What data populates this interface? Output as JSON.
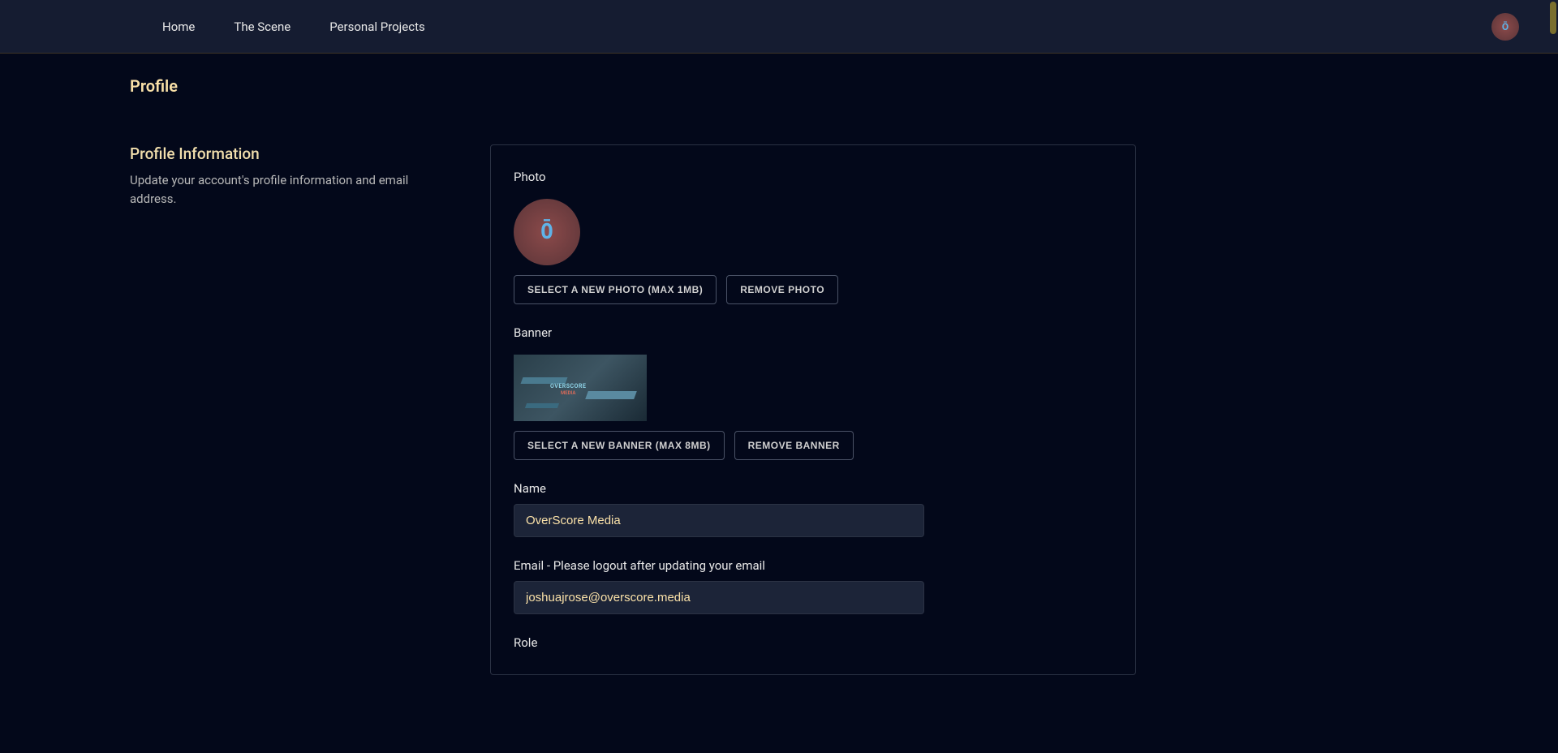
{
  "nav": {
    "items": [
      {
        "label": "Home"
      },
      {
        "label": "The Scene"
      },
      {
        "label": "Personal Projects"
      }
    ],
    "avatar_glyph": "Ō"
  },
  "page": {
    "title": "Profile"
  },
  "section": {
    "heading": "Profile Information",
    "description": "Update your account's profile information and email address."
  },
  "form": {
    "photo": {
      "label": "Photo",
      "glyph": "Ō",
      "select_btn": "SELECT A NEW PHOTO (MAX 1MB)",
      "remove_btn": "REMOVE PHOTO"
    },
    "banner": {
      "label": "Banner",
      "text": "OVERSCORE",
      "subtext": "MEDIA",
      "select_btn": "SELECT A NEW BANNER (MAX 8MB)",
      "remove_btn": "REMOVE BANNER"
    },
    "name": {
      "label": "Name",
      "value": "OverScore Media"
    },
    "email": {
      "label": "Email - Please logout after updating your email",
      "value": "joshuajrose@overscore.media"
    },
    "role": {
      "label": "Role"
    }
  }
}
